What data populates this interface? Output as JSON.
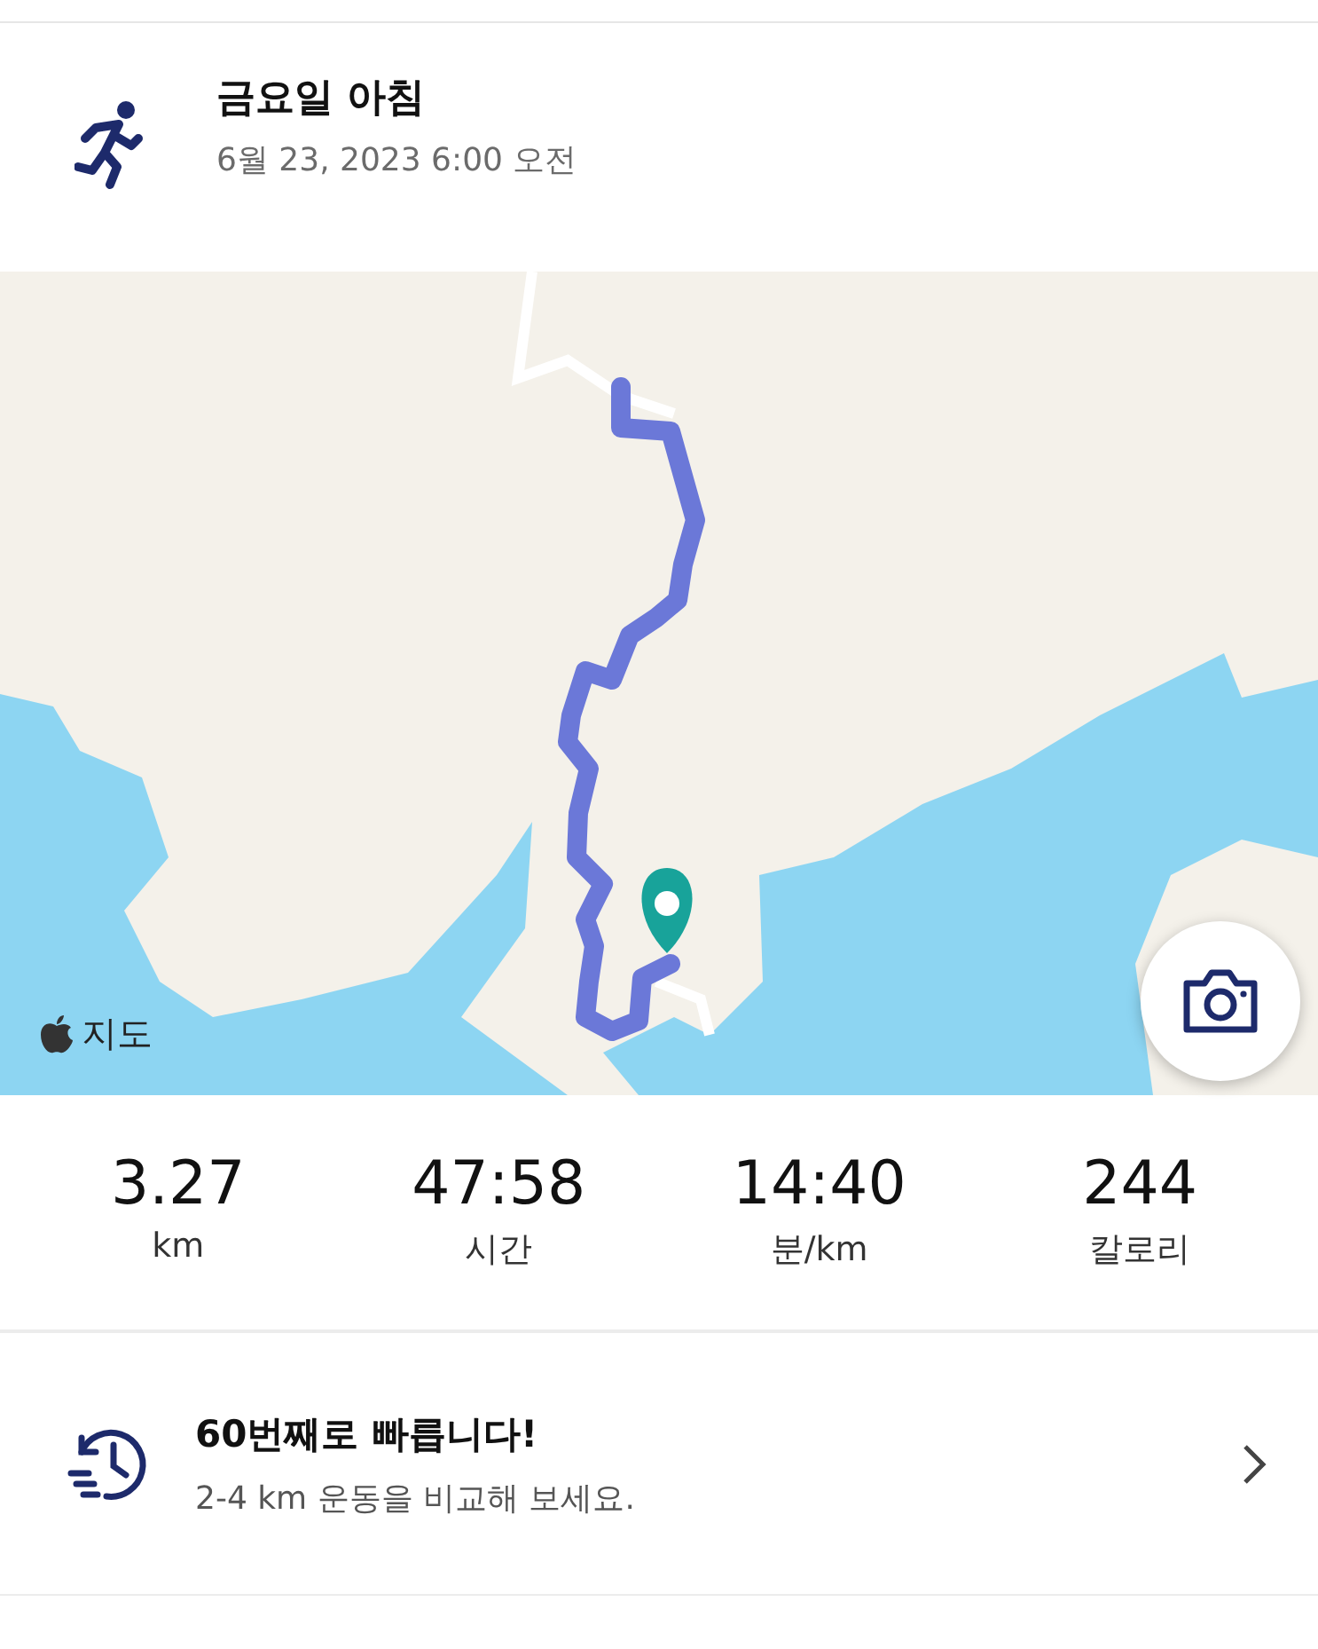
{
  "activity": {
    "title": "금요일 아침",
    "date": "6월 23, 2023 6:00 오전"
  },
  "map": {
    "kind": "picture",
    "attribution": "지도"
  },
  "stats": [
    {
      "value": "3.27",
      "label": "km"
    },
    {
      "value": "47:58",
      "label": "시간"
    },
    {
      "value": "14:40",
      "label": "분/km"
    },
    {
      "value": "244",
      "label": "칼로리"
    }
  ],
  "comparison": {
    "title": "60번째로 빠릅니다!",
    "subtitle": "2-4 km 운동을 비교해 보세요."
  }
}
